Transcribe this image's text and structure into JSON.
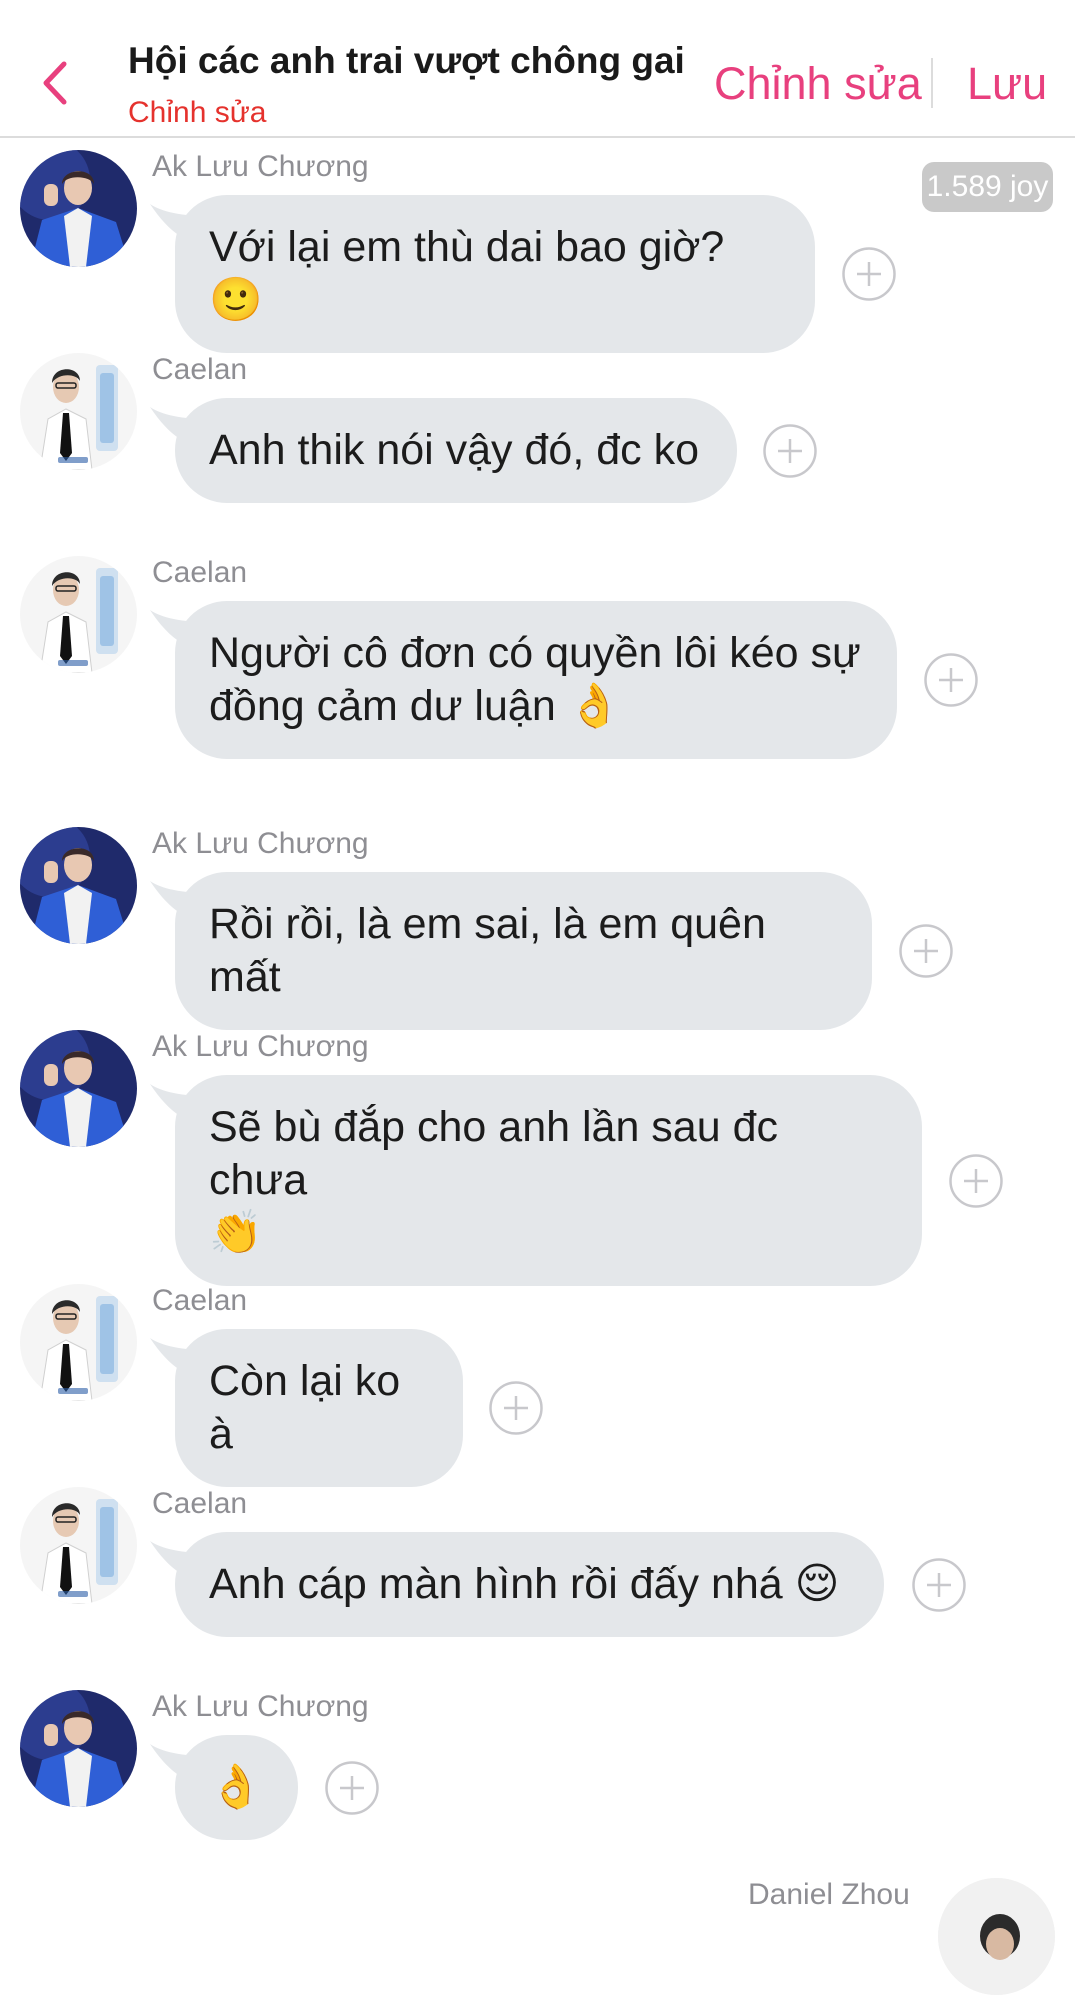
{
  "header": {
    "title": "Hội các anh trai vượt chông gai",
    "subtitle": "Chỉnh sửa",
    "edit_label": "Chỉnh sửa",
    "save_label": "Lưu",
    "accent_color": "#e8407e",
    "subtitle_color": "#e5322d"
  },
  "badge": {
    "text": "1.589 joy"
  },
  "messages": [
    {
      "sender": "Ak Lưu Chương",
      "lines": [
        "Với lại em thù dai bao giờ? 🙂"
      ],
      "avatar": "blue-jacket-avatar"
    },
    {
      "sender": "Caelan",
      "lines": [
        "Anh thik nói vậy đó, đc ko"
      ],
      "avatar": "white-shirt-avatar"
    },
    {
      "sender": "Caelan",
      "lines": [
        "Người cô đơn có quyền lôi kéo sự",
        "đồng cảm dư luận 👌"
      ],
      "avatar": "white-shirt-avatar"
    },
    {
      "sender": "Ak Lưu Chương",
      "lines": [
        "Rồi rồi, là em sai, là em quên mất"
      ],
      "avatar": "blue-jacket-avatar"
    },
    {
      "sender": "Ak Lưu Chương",
      "lines": [
        "Sẽ bù đắp cho anh lần sau đc chưa",
        "👏"
      ],
      "avatar": "blue-jacket-avatar"
    },
    {
      "sender": "Caelan",
      "lines": [
        "Còn lại ko à"
      ],
      "avatar": "white-shirt-avatar"
    },
    {
      "sender": "Caelan",
      "lines": [
        "Anh cáp màn hình rồi đấy nhá 😌"
      ],
      "avatar": "white-shirt-avatar"
    },
    {
      "sender": "Ak Lưu Chương",
      "lines": [
        "👌"
      ],
      "avatar": "blue-jacket-avatar"
    }
  ],
  "bottom": {
    "sender": "Daniel Zhou"
  },
  "colors": {
    "bubble": "#e4e7ea",
    "sender_text": "#8e8e93"
  }
}
